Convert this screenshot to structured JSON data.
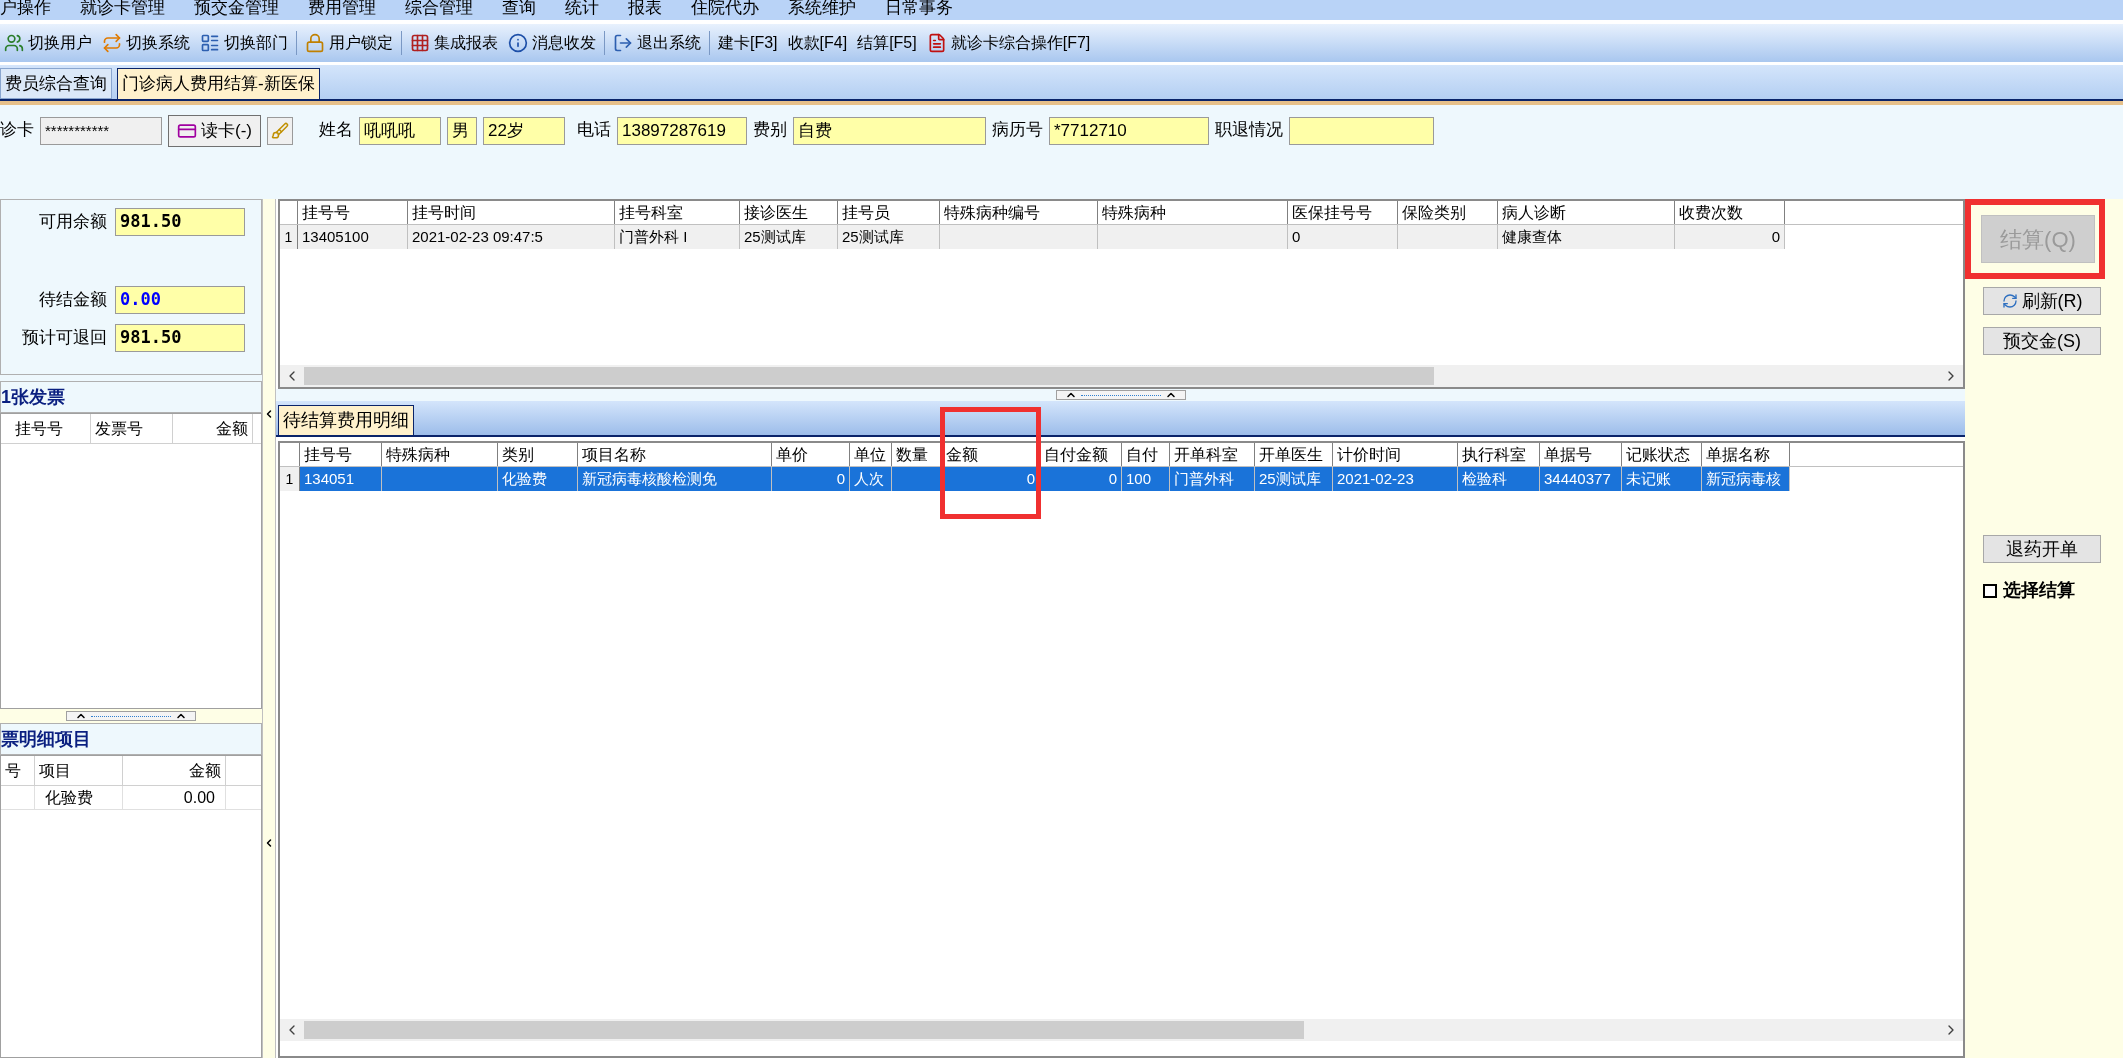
{
  "menu": [
    "户操作",
    "就诊卡管理",
    "预交金管理",
    "费用管理",
    "综合管理",
    "查询",
    "统计",
    "报表",
    "住院代办",
    "系统维护",
    "日常事务"
  ],
  "toolbar": [
    "切换用户",
    "切换系统",
    "切换部门",
    "用户锁定",
    "集成报表",
    "消息收发",
    "退出系统",
    "建卡[F3]",
    "收款[F4]",
    "结算[F5]",
    "就诊卡综合操作[F7]"
  ],
  "tabs": [
    {
      "label": "费员综合查询",
      "selected": false
    },
    {
      "label": "门诊病人费用结算-新医保",
      "selected": true
    }
  ],
  "patient": {
    "card_label": "诊卡",
    "card_value": "***********",
    "read_card_button": "读卡(-)",
    "name_label": "姓名",
    "name": "吼吼吼",
    "sex": "男",
    "age": "22岁",
    "phone_label": "电话",
    "phone": "13897287619",
    "fee_type_label": "费别",
    "fee_type": "自费",
    "record_label": "病历号",
    "record": "*7712710",
    "retire_label": "职退情况"
  },
  "balance": [
    {
      "label": "可用余额",
      "value": "981.50",
      "highlight": false
    },
    {
      "label": "待结金额",
      "value": "0.00",
      "highlight": true
    },
    {
      "label": "预计可退回",
      "value": "981.50",
      "highlight": false
    }
  ],
  "invoice_panel": {
    "title": "1张发票",
    "columns": [
      "挂号号",
      "发票号",
      "金额"
    ]
  },
  "detail_panel": {
    "title": "票明细项目",
    "columns": [
      "号",
      "项目",
      "金额"
    ],
    "rows": [
      {
        "item": "化验费",
        "amount": "0.00"
      }
    ]
  },
  "registration_grid": {
    "columns": [
      "挂号号",
      "挂号时间",
      "挂号科室",
      "接诊医生",
      "挂号员",
      "特殊病种编号",
      "特殊病种",
      "医保挂号号",
      "保险类别",
      "病人诊断",
      "收费次数"
    ],
    "rows": [
      {
        "index": "1",
        "selected": false,
        "cells": [
          "13405100",
          "2021-02-23 09:47:5",
          "门普外科 I",
          "25测试库",
          "25测试库",
          null,
          null,
          "0",
          null,
          "健康查体",
          "0"
        ]
      }
    ]
  },
  "pending_tab": {
    "label": "待结算费用明细",
    "selected": true
  },
  "fee_grid": {
    "columns": [
      "挂号号",
      "特殊病种",
      "类别",
      "项目名称",
      "单价",
      "单位",
      "数量",
      "金额",
      "自付金额",
      "自付",
      "开单科室",
      "开单医生",
      "计价时间",
      "执行科室",
      "单据号",
      "记账状态",
      "单据名称"
    ],
    "rows": [
      {
        "index": "1",
        "selected": true,
        "cells": [
          "134051",
          null,
          "化验费",
          "新冠病毒核酸检测免",
          "0",
          "人次",
          null,
          "0",
          "0",
          "100",
          "门普外科",
          "25测试库",
          "2021-02-23",
          "检验科",
          "34440377",
          "未记账",
          "新冠病毒核"
        ]
      }
    ]
  },
  "actions": [
    {
      "label": "结算(Q)",
      "disabled": true
    },
    {
      "label": "刷新(R)",
      "disabled": false
    },
    {
      "label": "预交金(S)",
      "disabled": false
    },
    {
      "label": "退药开单",
      "disabled": false
    }
  ],
  "select_settle": {
    "label": "选择结算",
    "checked": false
  }
}
